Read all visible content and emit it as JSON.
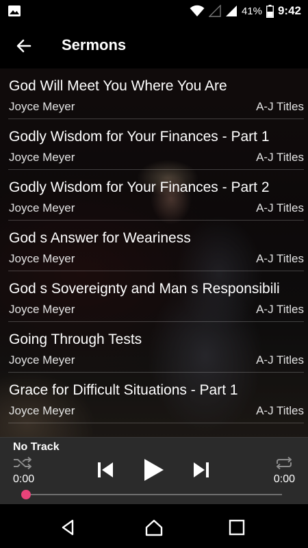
{
  "status_bar": {
    "battery": "41%",
    "time": "9:42",
    "icons": [
      "gallery-icon",
      "wifi-icon",
      "no-signal-icon",
      "cell-signal-icon",
      "battery-icon"
    ]
  },
  "app_bar": {
    "title": "Sermons",
    "back_icon": "back-arrow-icon"
  },
  "sermons": [
    {
      "title": "God Will Meet You Where You Are",
      "author": "Joyce Meyer",
      "category": "A-J Titles"
    },
    {
      "title": "Godly Wisdom for Your Finances - Part 1",
      "author": "Joyce Meyer",
      "category": "A-J Titles"
    },
    {
      "title": "Godly Wisdom for Your Finances - Part 2",
      "author": "Joyce Meyer",
      "category": "A-J Titles"
    },
    {
      "title": "God s Answer for Weariness",
      "author": "Joyce Meyer",
      "category": "A-J Titles"
    },
    {
      "title": "God s Sovereignty and Man s Responsibili",
      "author": "Joyce Meyer",
      "category": "A-J Titles"
    },
    {
      "title": "Going Through Tests",
      "author": "Joyce Meyer",
      "category": "A-J Titles"
    },
    {
      "title": "Grace for Difficult Situations - Part 1",
      "author": "Joyce Meyer",
      "category": "A-J Titles"
    }
  ],
  "player": {
    "track": "No Track",
    "elapsed": "0:00",
    "duration": "0:00",
    "progress": 0,
    "accent": "#e8437a",
    "icons": [
      "shuffle-icon",
      "previous-icon",
      "play-icon",
      "next-icon",
      "repeat-icon"
    ]
  },
  "nav_bar": {
    "icons": [
      "nav-back-icon",
      "nav-home-icon",
      "nav-recents-icon"
    ]
  }
}
